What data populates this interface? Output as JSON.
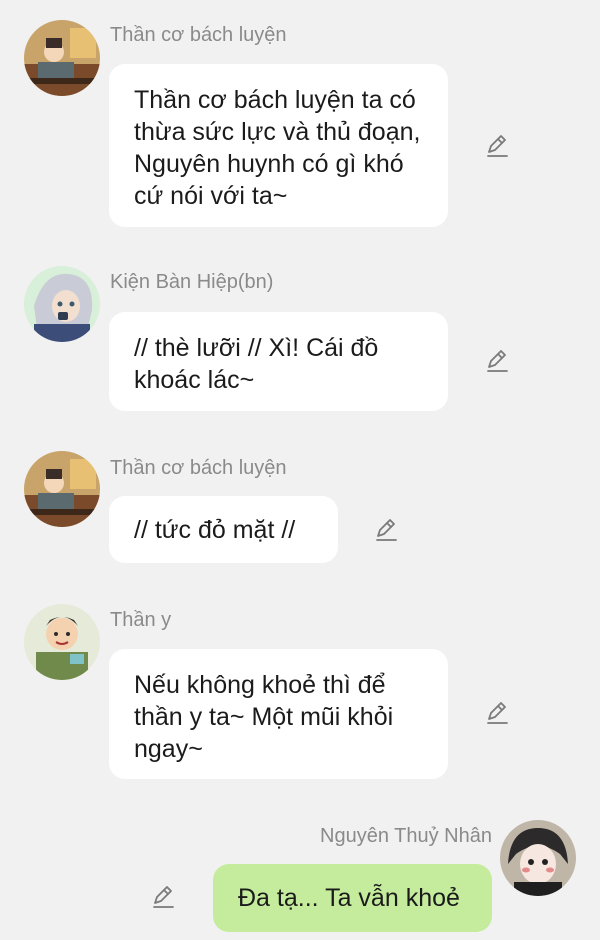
{
  "messages": [
    {
      "sender": "Thần cơ bách luyện",
      "text": "Thần cơ bách luyện ta có thừa sức lực và thủ đoạn, Nguyên huynh có gì khó cứ nói với ta~",
      "avatar_icon": "anime-warrior-avatar-icon",
      "side": "left"
    },
    {
      "sender": "Kiện Bàn Hiệp(bn)",
      "text": "// thè lưỡi // Xì! Cái đồ khoác lác~",
      "avatar_icon": "silver-hair-avatar-icon",
      "side": "left"
    },
    {
      "sender": "Thần cơ bách luyện",
      "text": "// tức đỏ mặt //",
      "avatar_icon": "anime-warrior-avatar-icon",
      "side": "left"
    },
    {
      "sender": "Thần y",
      "text": "Nếu không khoẻ thì để thần y ta~ Một mũi khỏi ngay~",
      "avatar_icon": "healer-avatar-icon",
      "side": "left"
    },
    {
      "sender": "Nguyên Thuỷ Nhân",
      "text": "Đa tạ... Ta vẫn khoẻ",
      "avatar_icon": "dark-hair-avatar-icon",
      "side": "right"
    }
  ],
  "colors": {
    "background": "#f1f1f1",
    "bubble_other": "#ffffff",
    "bubble_self": "#c4ec9c",
    "sender_text": "#8a8a8a",
    "edit_icon": "#7a7a7a"
  }
}
